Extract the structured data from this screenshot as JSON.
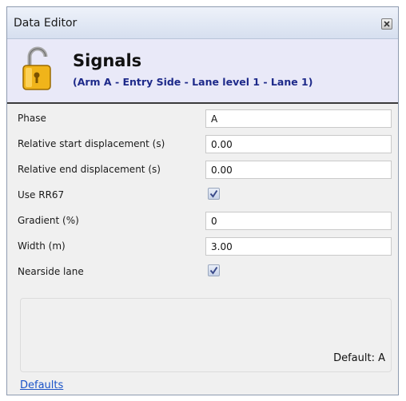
{
  "window": {
    "title": "Data Editor"
  },
  "header": {
    "title": "Signals",
    "subtitle": "(Arm A - Entry Side - Lane level 1 - Lane 1)",
    "icon": "padlock-icon"
  },
  "properties": [
    {
      "label": "Phase",
      "type": "text",
      "value": "A"
    },
    {
      "label": "Relative start displacement (s)",
      "type": "text",
      "value": "0.00"
    },
    {
      "label": "Relative end displacement (s)",
      "type": "text",
      "value": "0.00"
    },
    {
      "label": "Use RR67",
      "type": "checkbox",
      "checked": true
    },
    {
      "label": "Gradient (%)",
      "type": "text",
      "value": "0"
    },
    {
      "label": "Width (m)",
      "type": "text",
      "value": "3.00"
    },
    {
      "label": "Nearside lane",
      "type": "checkbox",
      "checked": true
    }
  ],
  "description": {
    "default_text": "Default: A"
  },
  "footer": {
    "defaults_link": "Defaults"
  },
  "colors": {
    "header_bg": "#e9e9f8",
    "subtitle": "#1e2a8a",
    "link": "#1a53c8",
    "lock_gold": "#f0b41a"
  }
}
